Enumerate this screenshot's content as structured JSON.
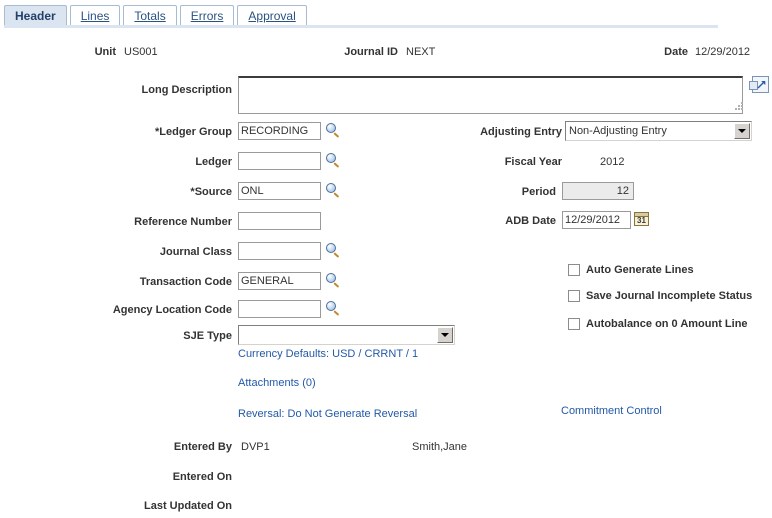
{
  "tabs": [
    {
      "label": "Header",
      "active": true
    },
    {
      "label": "Lines",
      "active": false
    },
    {
      "label": "Totals",
      "active": false
    },
    {
      "label": "Errors",
      "active": false
    },
    {
      "label": "Approval",
      "active": false
    }
  ],
  "summary": {
    "unit_label": "Unit",
    "unit_value": "US001",
    "journal_id_label": "Journal ID",
    "journal_id_value": "NEXT",
    "date_label": "Date",
    "date_value": "12/29/2012"
  },
  "long_description": {
    "label": "Long Description",
    "value": "",
    "expand_icon": "expand-popup-icon"
  },
  "left_fields": {
    "ledger_group": {
      "label": "*Ledger Group",
      "value": "RECORDING",
      "lookup_icon": "search-lookup-icon"
    },
    "ledger": {
      "label": "Ledger",
      "value": "",
      "lookup_icon": "search-lookup-icon"
    },
    "source": {
      "label": "*Source",
      "value": "ONL",
      "lookup_icon": "search-lookup-icon"
    },
    "reference_number": {
      "label": "Reference Number",
      "value": ""
    },
    "journal_class": {
      "label": "Journal Class",
      "value": "",
      "lookup_icon": "search-lookup-icon"
    },
    "transaction_code": {
      "label": "Transaction Code",
      "value": "GENERAL",
      "lookup_icon": "search-lookup-icon"
    },
    "agency_location_code": {
      "label": "Agency Location Code",
      "value": "",
      "lookup_icon": "search-lookup-icon"
    },
    "sje_type": {
      "label": "SJE Type",
      "value": "",
      "dropdown_icon": "chevron-down-icon"
    }
  },
  "right_fields": {
    "adjusting_entry": {
      "label": "Adjusting Entry",
      "value": "Non-Adjusting Entry",
      "dropdown_icon": "chevron-down-icon"
    },
    "fiscal_year": {
      "label": "Fiscal Year",
      "value": "2012"
    },
    "period": {
      "label": "Period",
      "value": "12"
    },
    "adb_date": {
      "label": "ADB Date",
      "value": "12/29/2012",
      "calendar_icon": "calendar-icon",
      "calendar_glyph": "31"
    }
  },
  "checkboxes": [
    {
      "label": "Auto Generate Lines",
      "checked": false
    },
    {
      "label": "Save Journal Incomplete Status",
      "checked": false
    },
    {
      "label": "Autobalance on 0 Amount Line",
      "checked": false
    }
  ],
  "links": {
    "currency_defaults": "Currency Defaults: USD / CRRNT / 1",
    "attachments": "Attachments (0)",
    "reversal": "Reversal: Do Not Generate Reversal",
    "commitment_control": "Commitment Control"
  },
  "audit": {
    "entered_by_label": "Entered By",
    "entered_by_value": "DVP1",
    "entered_by_name": "Smith,Jane",
    "entered_on_label": "Entered On",
    "entered_on_value": "",
    "last_updated_on_label": "Last Updated On",
    "last_updated_on_value": ""
  },
  "colors": {
    "link": "#2259a8",
    "tab_active_bg": "#dbe5f1",
    "tab_border": "#a6bcd5",
    "label_text": "#333333",
    "readonly_bg": "#ebebeb"
  }
}
